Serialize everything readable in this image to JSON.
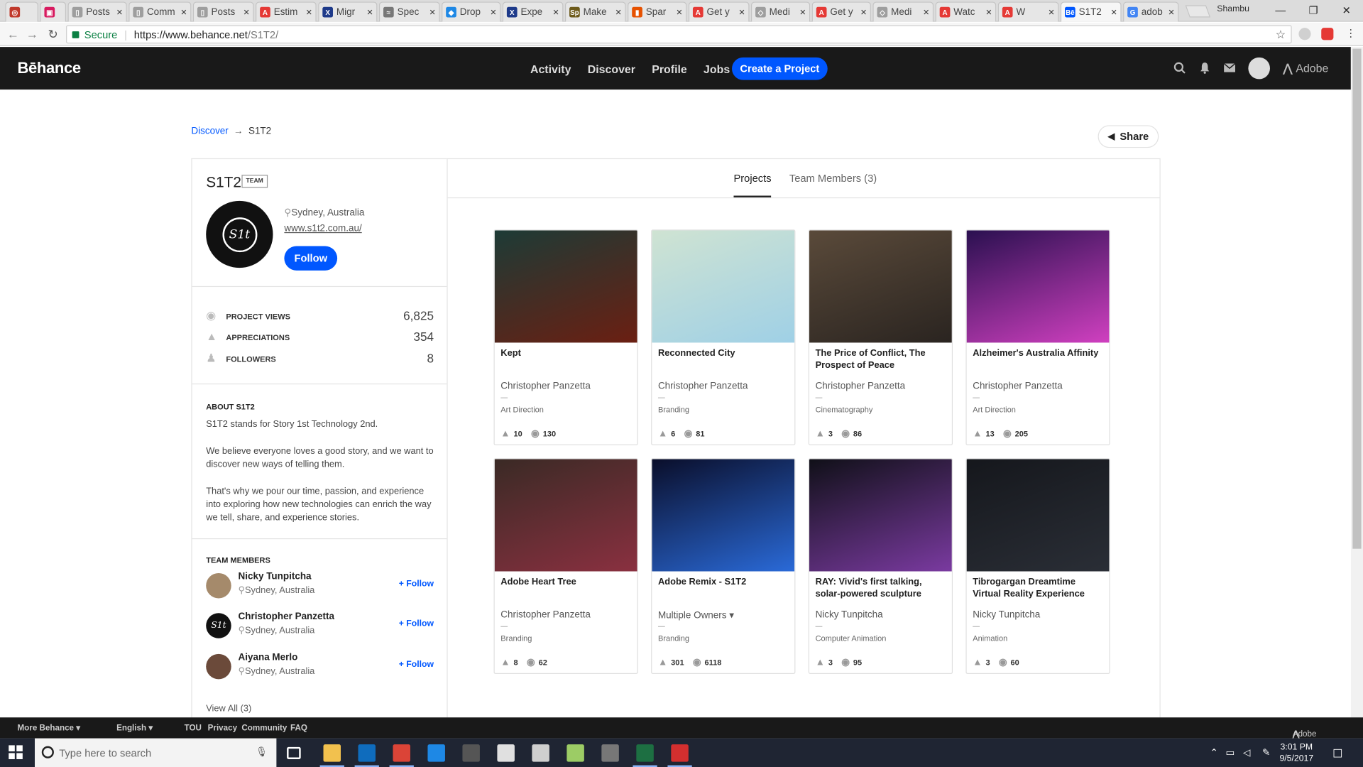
{
  "browser": {
    "tabs": [
      {
        "label": "",
        "color": "#c0392b",
        "glyph": "◎"
      },
      {
        "label": "",
        "color": "#d81b60",
        "glyph": "▣"
      },
      {
        "label": "Posts",
        "color": "#9e9e9e",
        "glyph": "▯"
      },
      {
        "label": "Comm",
        "color": "#9e9e9e",
        "glyph": "▯"
      },
      {
        "label": "Posts",
        "color": "#9e9e9e",
        "glyph": "▯"
      },
      {
        "label": "Estim",
        "color": "#e53935",
        "glyph": "A"
      },
      {
        "label": "Migr",
        "color": "#1e3a8a",
        "glyph": "X"
      },
      {
        "label": "Spec",
        "color": "#777777",
        "glyph": "≈"
      },
      {
        "label": "Drop",
        "color": "#1e88e5",
        "glyph": "◆"
      },
      {
        "label": "Expe",
        "color": "#1e3a8a",
        "glyph": "X"
      },
      {
        "label": "Make",
        "color": "#6d5a1a",
        "glyph": "Sp"
      },
      {
        "label": "Spar",
        "color": "#e65100",
        "glyph": "▮"
      },
      {
        "label": "Get y",
        "color": "#e53935",
        "glyph": "A"
      },
      {
        "label": "Medi",
        "color": "#9e9e9e",
        "glyph": "◇"
      },
      {
        "label": "Get y",
        "color": "#e53935",
        "glyph": "A"
      },
      {
        "label": "Medi",
        "color": "#9e9e9e",
        "glyph": "◇"
      },
      {
        "label": "Watc",
        "color": "#e53935",
        "glyph": "A"
      },
      {
        "label": "W",
        "color": "#e53935",
        "glyph": "A"
      },
      {
        "label": "S1T2",
        "color": "#0057ff",
        "glyph": "Bē"
      },
      {
        "label": "adob",
        "color": "#4285f4",
        "glyph": "G"
      }
    ],
    "active_tab_index": 18,
    "user_chip": "Shambu",
    "secure_label": "Secure",
    "url_host": "https://www.behance.net",
    "url_path": "/S1T2/"
  },
  "header": {
    "logo": "Bēhance",
    "nav": [
      "Activity",
      "Discover",
      "Profile",
      "Jobs"
    ],
    "create_label": "Create a Project",
    "adobe_label": "Adobe"
  },
  "breadcrumb": {
    "parent": "Discover",
    "arrow": "→",
    "current": "S1T2"
  },
  "share_label": "Share",
  "profile": {
    "name": "S1T2",
    "badge": "TEAM",
    "logo_text": "S1t",
    "location": "Sydney, Australia",
    "website": "www.s1t2.com.au/",
    "follow_label": "Follow"
  },
  "stats": [
    {
      "label": "PROJECT VIEWS",
      "value": "6,825",
      "icon": "eye-icon"
    },
    {
      "label": "APPRECIATIONS",
      "value": "354",
      "icon": "thumbs-up-icon"
    },
    {
      "label": "FOLLOWERS",
      "value": "8",
      "icon": "followers-icon"
    }
  ],
  "about": {
    "title": "ABOUT S1T2",
    "p1": "S1T2 stands for Story 1st Technology 2nd.",
    "p2": "We believe everyone loves a good story, and we want to discover new ways of telling them.",
    "p3": "That's why we pour our time, passion, and experience into exploring how new technologies can enrich the way we tell, share, and experience stories."
  },
  "team": {
    "title": "TEAM MEMBERS",
    "follow_label": "+ Follow",
    "members": [
      {
        "name": "Nicky Tunpitcha",
        "location": "Sydney, Australia"
      },
      {
        "name": "Christopher Panzetta",
        "location": "Sydney, Australia"
      },
      {
        "name": "Aiyana Merlo",
        "location": "Sydney, Australia"
      }
    ],
    "view_all": "View All (3)"
  },
  "tabs": {
    "projects": "Projects",
    "team_members": "Team Members (3)"
  },
  "projects": [
    {
      "title": "Kept",
      "owner": "Christopher Panzetta",
      "field": "Art Direction",
      "likes": "10",
      "views": "130",
      "colors": [
        "#1d3b36",
        "#6b1f12"
      ]
    },
    {
      "title": "Reconnected City",
      "owner": "Christopher Panzetta",
      "field": "Branding",
      "likes": "6",
      "views": "81",
      "colors": [
        "#cfe3d2",
        "#9fd0e6"
      ]
    },
    {
      "title": "The Price of Conflict, The Prospect of Peace",
      "owner": "Christopher Panzetta",
      "field": "Cinematography",
      "likes": "3",
      "views": "86",
      "colors": [
        "#5a4a3a",
        "#2a2420"
      ]
    },
    {
      "title": "Alzheimer's Australia Affinity",
      "owner": "Christopher Panzetta",
      "field": "Art Direction",
      "likes": "13",
      "views": "205",
      "colors": [
        "#2a1050",
        "#d040c0"
      ]
    },
    {
      "title": "Adobe Heart Tree",
      "owner": "Christopher Panzetta",
      "field": "Branding",
      "likes": "8",
      "views": "62",
      "colors": [
        "#3a2a25",
        "#8a3040"
      ]
    },
    {
      "title": "Adobe Remix - S1T2",
      "owner": "Multiple Owners",
      "field": "Branding",
      "likes": "301",
      "views": "6118",
      "colors": [
        "#0a0e2a",
        "#2a6ad8"
      ]
    },
    {
      "title": "RAY: Vivid's first talking, solar-powered sculpture",
      "owner": "Nicky Tunpitcha",
      "field": "Computer Animation",
      "likes": "3",
      "views": "95",
      "colors": [
        "#101018",
        "#7a3aa0"
      ]
    },
    {
      "title": "Tibrogargan Dreamtime Virtual Reality Experience",
      "owner": "Nicky Tunpitcha",
      "field": "Animation",
      "likes": "3",
      "views": "60",
      "colors": [
        "#15171c",
        "#2a2e36"
      ]
    }
  ],
  "footer": {
    "more": "More Behance ▾",
    "lang": "English ▾",
    "tou": "TOU",
    "privacy": "Privacy",
    "community": "Community",
    "faq": "FAQ",
    "adobe": "Adobe"
  },
  "taskbar": {
    "search_placeholder": "Type here to search",
    "time": "3:01 PM",
    "date": "9/5/2017",
    "apps": [
      {
        "name": "task-view-icon",
        "color": "#1f2533"
      },
      {
        "name": "file-explorer-icon",
        "color": "#f2c14e"
      },
      {
        "name": "outlook-icon",
        "color": "#0f6cbd"
      },
      {
        "name": "chrome-icon",
        "color": "#db4437"
      },
      {
        "name": "edge-icon",
        "color": "#1e88e5"
      },
      {
        "name": "calculator-icon",
        "color": "#555555"
      },
      {
        "name": "java-icon",
        "color": "#e0e0e0"
      },
      {
        "name": "paint-icon",
        "color": "#cfcfcf"
      },
      {
        "name": "notepad-icon",
        "color": "#9ccc65"
      },
      {
        "name": "vm-icon",
        "color": "#777777"
      },
      {
        "name": "excel-icon",
        "color": "#1d6f42"
      },
      {
        "name": "acrobat-icon",
        "color": "#d32f2f"
      }
    ]
  }
}
